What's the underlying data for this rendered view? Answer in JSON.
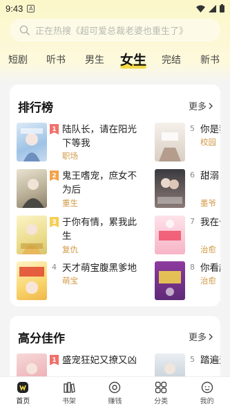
{
  "status": {
    "time": "9:43",
    "a_label": "A"
  },
  "search": {
    "placeholder": "正在热搜《超可爱总裁老婆也重生了》"
  },
  "tabs": [
    {
      "label": "短剧"
    },
    {
      "label": "听书"
    },
    {
      "label": "男生"
    },
    {
      "label": "女生"
    },
    {
      "label": "完结"
    },
    {
      "label": "新书"
    }
  ],
  "ranking": {
    "title": "排行榜",
    "more": "更多",
    "left": [
      {
        "rank": "1",
        "title": "陆队长，请在阳光下等我",
        "tag": "职场",
        "badge_color": "#f2706b"
      },
      {
        "rank": "2",
        "title": "鬼王嗜宠，庶女不为后",
        "tag": "重生",
        "badge_color": "#f5a34a"
      },
      {
        "rank": "3",
        "title": "于你有情，累我此生",
        "tag": "复仇",
        "badge_color": "#f5cf56"
      },
      {
        "rank": "4",
        "title": "天才萌宝腹黑爹地",
        "tag": "萌宝"
      }
    ],
    "right": [
      {
        "rank": "5",
        "title": "你是我",
        "tag": "校园"
      },
      {
        "rank": "6",
        "title": "甜溺！下跪",
        "tag": "墨爷"
      },
      {
        "rank": "7",
        "title": "我在七富",
        "tag": "治愈"
      },
      {
        "rank": "8",
        "title": "你看起",
        "tag": "治愈"
      }
    ]
  },
  "highscore": {
    "title": "高分佳作",
    "more": "更多",
    "left": {
      "rank": "1",
      "title": "盛宠狂妃又撩又凶",
      "badge_color": "#f2706b"
    },
    "right": {
      "rank": "5",
      "title": "踏遍天"
    }
  },
  "bottom_nav": [
    {
      "label": "首页",
      "icon": "home-icon"
    },
    {
      "label": "书架",
      "icon": "bookshelf-icon"
    },
    {
      "label": "赚钱",
      "icon": "earn-icon"
    },
    {
      "label": "分类",
      "icon": "category-icon"
    },
    {
      "label": "我的",
      "icon": "profile-icon"
    }
  ],
  "colors": {
    "accent": "#f4d94a",
    "tag": "#d29a47"
  }
}
